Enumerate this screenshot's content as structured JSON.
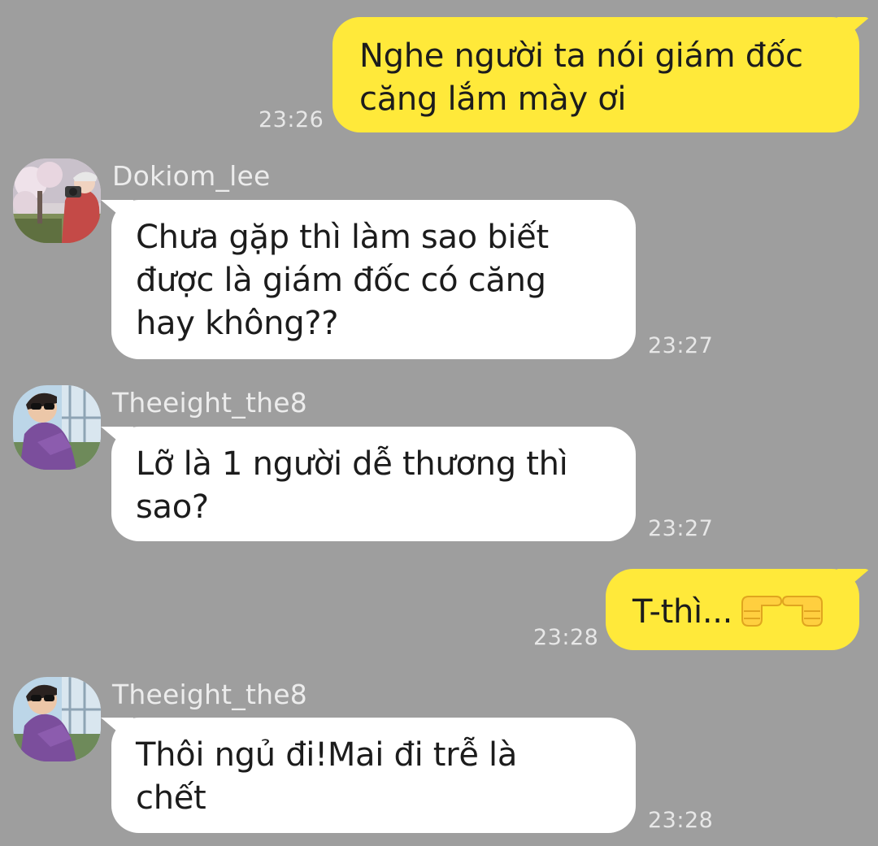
{
  "messages": [
    {
      "direction": "outgoing",
      "lines": [
        "Nghe người ta nói giám đốc",
        "căng lắm mày ơi"
      ],
      "time": "23:26"
    },
    {
      "direction": "incoming",
      "sender": "Dokiom_lee",
      "avatar": "photo-person-cherry-blossoms",
      "lines": [
        "Chưa gặp thì làm sao biết",
        "được là giám đốc có căng",
        "hay không??"
      ],
      "time": "23:27"
    },
    {
      "direction": "incoming",
      "sender": "Theeight_the8",
      "avatar": "photo-person-purple-sweater",
      "lines": [
        "Lỡ là 1 người dễ thương thì",
        "sao?"
      ],
      "time": "23:27"
    },
    {
      "direction": "outgoing",
      "lines": [
        "T-thì..."
      ],
      "emoji": "pointing-index-fingers-icon",
      "time": "23:28"
    },
    {
      "direction": "incoming",
      "sender": "Theeight_the8",
      "avatar": "photo-person-purple-sweater",
      "lines": [
        "Thôi ngủ đi!Mai đi trễ là",
        "chết"
      ],
      "time": "23:28"
    }
  ],
  "colors": {
    "background": "#9e9e9e",
    "outgoing_bubble": "#ffe93a",
    "incoming_bubble": "#ffffff",
    "meta_text": "#e7e7e7"
  }
}
